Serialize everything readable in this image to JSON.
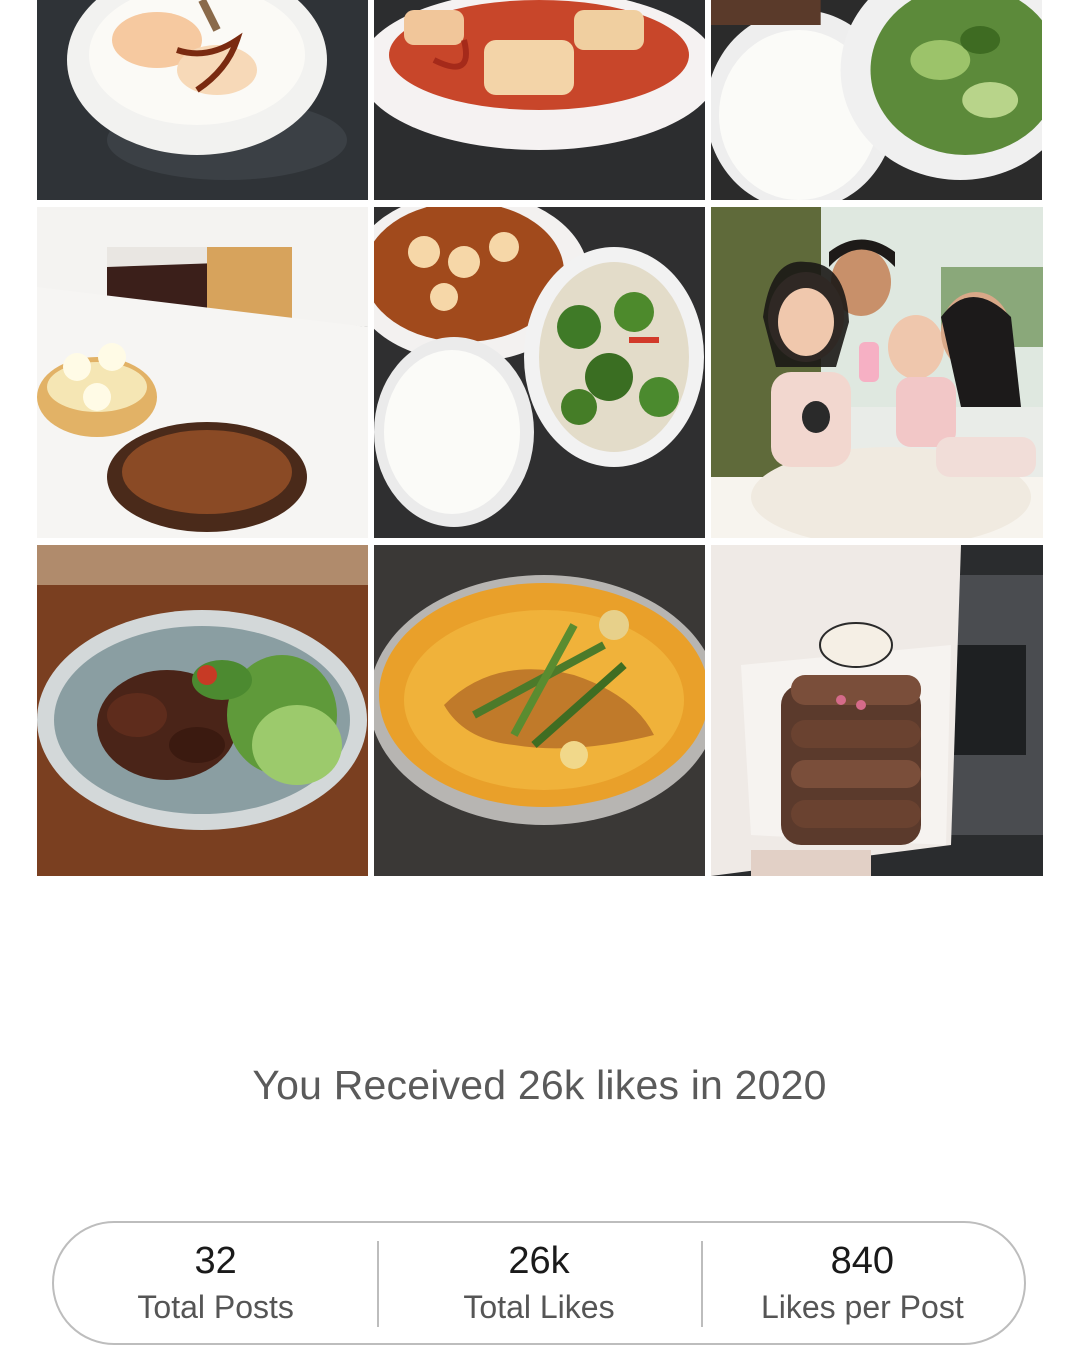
{
  "photos": [
    {
      "id": "photo-1",
      "subject": "onsen-eggs-bowl"
    },
    {
      "id": "photo-2",
      "subject": "sambal-squid-plate"
    },
    {
      "id": "photo-3",
      "subject": "rice-and-greens"
    },
    {
      "id": "photo-4",
      "subject": "cake-and-tarts-box"
    },
    {
      "id": "photo-5",
      "subject": "chicken-rice-broccoli"
    },
    {
      "id": "photo-6",
      "subject": "family-selfie"
    },
    {
      "id": "photo-7",
      "subject": "beef-salad-bowl"
    },
    {
      "id": "photo-8",
      "subject": "fish-curry"
    },
    {
      "id": "photo-9",
      "subject": "chocolate-eclair-box"
    }
  ],
  "summary": {
    "headline": "You Received 26k likes in 2020"
  },
  "stats": {
    "posts": {
      "value": "32",
      "label": "Total Posts"
    },
    "likes": {
      "value": "26k",
      "label": "Total Likes"
    },
    "per_post": {
      "value": "840",
      "label": "Likes per Post"
    }
  },
  "colors": {
    "text_dark": "#1a1a1a",
    "text_muted": "#5a5a5a",
    "border": "#bdbdbd"
  }
}
